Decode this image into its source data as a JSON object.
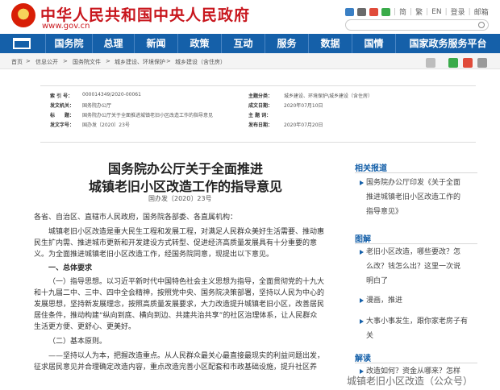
{
  "header": {
    "title": "中华人民共和国中央人民政府",
    "url": "www.gov.cn",
    "tools": [
      "简",
      "繁",
      "EN",
      "登录",
      "邮箱"
    ]
  },
  "nav": {
    "items": [
      "国务院",
      "总理",
      "新闻",
      "政策",
      "互动",
      "服务",
      "数据",
      "国情"
    ],
    "wide_item": "国家政务服务平台"
  },
  "breadcrumb": {
    "home": "首页",
    "path": [
      "信息公开",
      "国务院文件",
      "城乡建设、环境保护",
      "城乡建设（含住房）"
    ]
  },
  "info": {
    "labels": {
      "index_no": "索 引 号：",
      "issuer": "发文机关：",
      "title": "标　　题：",
      "doc_no": "发文字号：",
      "subject": "主 题 词：",
      "category": "主题分类：",
      "created": "成文日期：",
      "published": "发布日期："
    },
    "values": {
      "index_no": "000014349/2020-00061",
      "issuer": "国务院办公厅",
      "title": "国务院办公厅关于全面推进城镇老旧小区改造工作的指导意见",
      "doc_no": "国办发〔2020〕23号",
      "subject": "",
      "category": "城乡建设、环境保护\\城乡建设（含住房）",
      "created": "2020年07月10日",
      "published": "2020年07月20日"
    }
  },
  "article": {
    "title_line1": "国务院办公厅关于全面推进",
    "title_line2": "城镇老旧小区改造工作的指导意见",
    "doc_no": "国办发〔2020〕23号",
    "p_recipients": "各省、自治区、直辖市人民政府，国务院各部委、各直属机构：",
    "p_intro_1": "城镇老旧小区改造是重大民生工程和发展工程，对满足人民群众美好生活需要、推动惠",
    "p_intro_2": "民生扩内需、推进城市更新和开发建设方式转型、促进经济高质量发展具有十分重要的意",
    "p_intro_3": "义。为全面推进城镇老旧小区改造工作，经国务院同意，现提出以下意见。",
    "h1": "一、总体要求",
    "p_guide_1": "（一）指导思想。以习近平新时代中国特色社会主义思想为指导，全面贯彻党的十九大",
    "p_guide_2": "和十九届二中、三中、四中全会精神，按照党中央、国务院决策部署，坚持以人民为中心的",
    "p_guide_3": "发展思想，坚持新发展理念，按照高质量发展要求，大力改造提升城镇老旧小区，改善居民",
    "p_guide_4": "居住条件，推动构建“纵向到底、横向到边、共建共治共享”的社区治理体系，让人民群众",
    "p_guide_5": "生活更方便、更舒心、更美好。",
    "h2": "（二）基本原则。",
    "p_principle_1": "——坚持以人为本，把握改造重点。从人民群众最关心最直接最现实的利益问题出发，",
    "p_principle_2": "征求居民意见并合理确定改造内容，重点改造完善小区配套和市政基础设施，提升社区养"
  },
  "sidebar": {
    "related_title": "相关报道",
    "related_1": "国务院办公厅印发《关于全面",
    "related_2": "推进城镇老旧小区改造工作的",
    "related_3": "指导意见》",
    "illus_title": "图解",
    "illus_1": "老旧小区改造，哪些要改？怎",
    "illus_2": "么改？钱怎么出？这里一次说",
    "illus_3": "明白了",
    "illus_4": "漫画，推进",
    "illus_5": "大事小事发生，跟你家老房子有",
    "illus_6": "关",
    "interp_title": "解读",
    "interp_1": "改造如何？资金从哪来？怎样"
  },
  "watermark": "城镇老旧小区改造（公众号）"
}
